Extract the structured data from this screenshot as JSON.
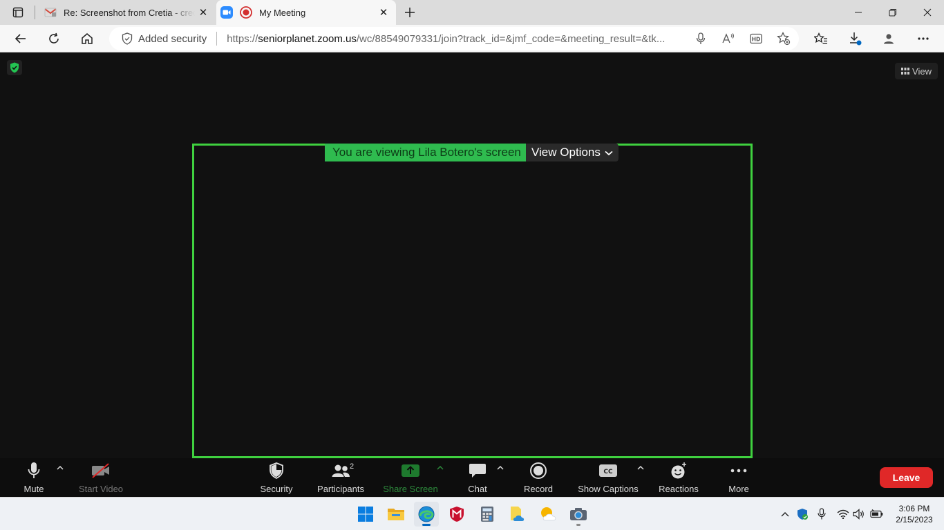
{
  "browser": {
    "tabs": [
      {
        "title": "Re: Screenshot from Cretia - cred",
        "active": false
      },
      {
        "title": "My Meeting",
        "active": true
      }
    ],
    "security_label": "Added security",
    "url_prefix": "https://",
    "url_host": "seniorplanet.zoom.us",
    "url_path": "/wc/88549079331/join?track_id=&jmf_code=&meeting_result=&tk..."
  },
  "meeting": {
    "view_label": "View",
    "viewing_banner": "You are viewing Lila Botero's screen",
    "view_options_label": "View Options"
  },
  "toolbar": {
    "mute": "Mute",
    "start_video": "Start Video",
    "security": "Security",
    "participants": "Participants",
    "participants_count": "2",
    "share_screen": "Share Screen",
    "chat": "Chat",
    "record": "Record",
    "show_captions": "Show Captions",
    "captions_badge": "CC",
    "reactions": "Reactions",
    "more": "More",
    "leave": "Leave"
  },
  "taskbar": {
    "time": "3:06 PM",
    "date": "2/15/2023"
  },
  "colors": {
    "share_frame": "#3fd13f",
    "banner_bg": "#2fbb4f",
    "leave_bg": "#e02828",
    "share_icon_bg": "#1e7a2e"
  }
}
